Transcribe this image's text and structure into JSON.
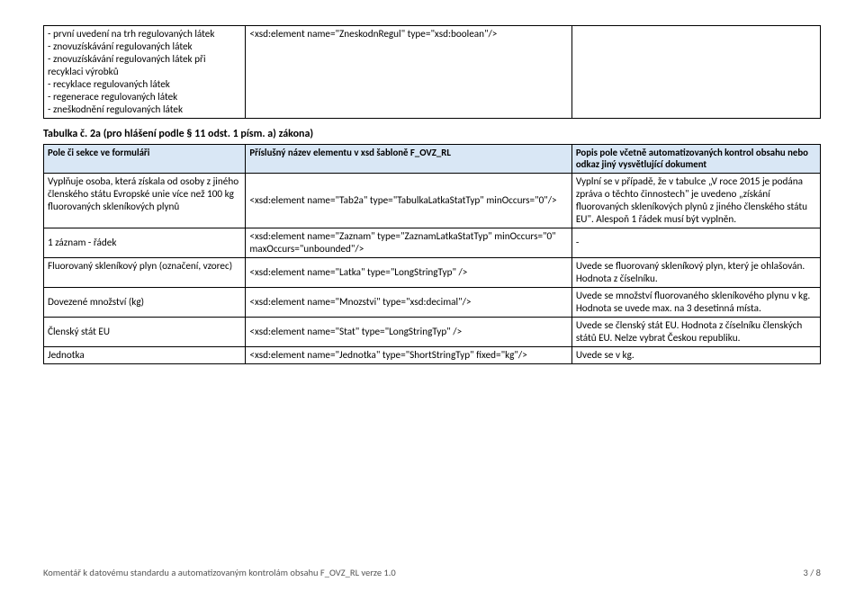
{
  "top_table": {
    "r0": {
      "c1": "- první uvedení na trh regulovaných látek\n- znovuzískávání regulovaných látek\n- znovuzískávání regulovaných látek při recyklaci výrobků\n- recyklace regulovaných látek\n- regenerace regulovaných látek\n- zneškodnění regulovaných látek",
      "c2": "<xsd:element name=\"ZneskodnRegul\" type=\"xsd:boolean\"/>",
      "c3": ""
    }
  },
  "heading": "Tabulka č. 2a (pro hlášení podle § 11 odst. 1 písm. a) zákona)",
  "table2": {
    "header": {
      "c1": "Pole či sekce ve formuláři",
      "c2": "Příslušný název elementu v xsd šabloně F_OVZ_RL",
      "c3": "Popis pole včetně automatizovaných kontrol obsahu nebo odkaz jiný vysvětlující dokument"
    },
    "rows": [
      {
        "c1": "Vyplňuje osoba, která získala od osoby z jiného členského státu Evropské unie více než 100 kg fluorovaných skleníkových plynů",
        "c2": "<xsd:element name=\"Tab2a\" type=\"TabulkaLatkaStatTyp\" minOccurs=\"0\"/>",
        "c3": "Vyplní se v případě, že v tabulce „V roce 2015 je podána zpráva o těchto činnostech\" je uvedeno „získání fluorovaných skleníkových plynů z jiného členského státu EU\". Alespoň 1 řádek musí být vyplněn."
      },
      {
        "c1": "1 záznam - řádek",
        "c2": "<xsd:element name=\"Zaznam\" type=\"ZaznamLatkaStatTyp\" minOccurs=\"0\" maxOccurs=\"unbounded\"/>",
        "c3": "-"
      },
      {
        "c1": "Fluorovaný skleníkový plyn (označení, vzorec)",
        "c2": "<xsd:element name=\"Latka\" type=\"LongStringTyp\" />",
        "c3": "Uvede se fluorovaný skleníkový plyn, který je ohlašován. Hodnota z číselníku."
      },
      {
        "c1": "Dovezené množství (kg)",
        "c2": "<xsd:element name=\"Mnozstvi\" type=\"xsd:decimal\"/>",
        "c3": "Uvede se množství fluorovaného skleníkového plynu v kg. Hodnota se uvede max. na 3 desetinná místa."
      },
      {
        "c1": "Členský stát EU",
        "c2": "<xsd:element name=\"Stat\" type=\"LongStringTyp\" />",
        "c3": "Uvede se členský stát EU. Hodnota z číselníku členských států EU. Nelze vybrat Českou republiku."
      },
      {
        "c1": "Jednotka",
        "c2": "<xsd:element name=\"Jednotka\" type=\"ShortStringTyp\" fixed=\"kg\"/>",
        "c3": "Uvede se v kg."
      }
    ]
  },
  "footer": {
    "left": "Komentář k datovému standardu a automatizovaným kontrolám obsahu F_OVZ_RL verze 1.0",
    "right": "3 / 8"
  }
}
